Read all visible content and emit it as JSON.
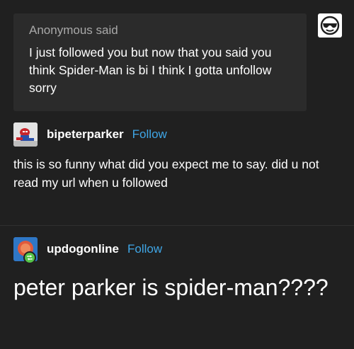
{
  "ask": {
    "asker": "Anonymous",
    "verb": "said",
    "text": "I just followed you but now that you said you think Spider-Man is bi I think I gotta unfollow sorry"
  },
  "reply_post": {
    "username": "bipeterparker",
    "follow_label": "Follow",
    "text": "this is so funny what did you expect me to say. did u not read my url when u followed"
  },
  "reblog_post": {
    "username": "updogonline",
    "follow_label": "Follow",
    "text": "peter parker is spider-man????"
  },
  "icons": {
    "anon_avatar": "sunglasses-face-icon",
    "reblog_badge": "reblog-icon"
  },
  "colors": {
    "background": "#202020",
    "ask_box": "#2b2b2b",
    "link": "#3fa6e6",
    "reblog_badge": "#55c448"
  }
}
